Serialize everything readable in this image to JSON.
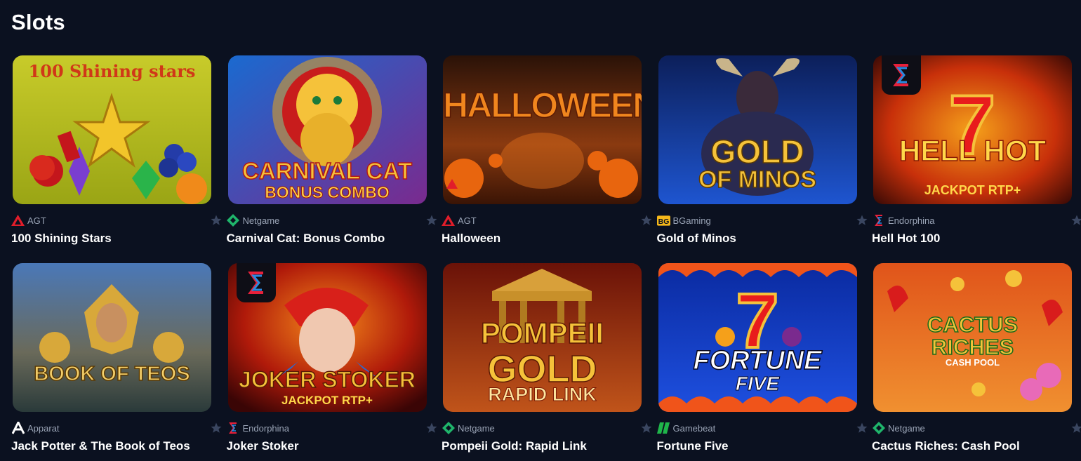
{
  "section": {
    "title": "Slots"
  },
  "games": [
    {
      "name": "100 Shining Stars",
      "provider": "AGT",
      "provider_icon": "agt-logo-icon",
      "art_text": "100 Shining stars",
      "colors": [
        "#c8cb2a",
        "#9aa515"
      ]
    },
    {
      "name": "Carnival Cat: Bonus Combo",
      "provider": "Netgame",
      "provider_icon": "netgame-logo-icon",
      "art_text": "CARNIVAL CAT",
      "art_sub": "BONUS COMBO",
      "colors": [
        "#1a6ad0",
        "#7a2a8e"
      ]
    },
    {
      "name": "Halloween",
      "provider": "AGT",
      "provider_icon": "agt-logo-icon",
      "art_text": "HALLOWEEN",
      "colors": [
        "#3a1a0c",
        "#c8521a"
      ]
    },
    {
      "name": "Gold of Minos",
      "provider": "BGaming",
      "provider_icon": "bgaming-logo-icon",
      "art_text": "GOLD",
      "art_sub": "OF MINOS",
      "colors": [
        "#102a7a",
        "#1e4fd0"
      ]
    },
    {
      "name": "Hell Hot 100",
      "provider": "Endorphina",
      "provider_icon": "endorphina-logo-icon",
      "art_text": "HELL HOT",
      "art_sub": "JACKPOT RTP+",
      "colors": [
        "#7a1a05",
        "#e04a10"
      ]
    },
    {
      "name": "Jack Potter & The Book of Teos",
      "provider": "Apparat",
      "provider_icon": "apparat-logo-icon",
      "art_text": "BOOK OF TEOS",
      "colors": [
        "#2b5fa5",
        "#8a6b3a"
      ]
    },
    {
      "name": "Joker Stoker",
      "provider": "Endorphina",
      "provider_icon": "endorphina-logo-icon",
      "art_text": "JOKER STOKER",
      "art_sub": "JACKPOT RTP+",
      "colors": [
        "#6a0a05",
        "#d8401a"
      ]
    },
    {
      "name": "Pompeii Gold: Rapid Link",
      "provider": "Netgame",
      "provider_icon": "netgame-logo-icon",
      "art_text": "POMPEII",
      "art_sub": "RAPID LINK",
      "colors": [
        "#5a0a05",
        "#c0541a"
      ]
    },
    {
      "name": "Fortune Five",
      "provider": "Gamebeat",
      "provider_icon": "gamebeat-logo-icon",
      "art_text": "FORTUNE",
      "art_sub": "FIVE",
      "colors": [
        "#0a2aa0",
        "#1e50e0"
      ]
    },
    {
      "name": "Cactus Riches: Cash Pool",
      "provider": "Netgame",
      "provider_icon": "netgame-logo-icon",
      "art_text": "CACTUS RICHES",
      "art_sub": "CASH POOL",
      "colors": [
        "#e0541a",
        "#f0a030"
      ]
    }
  ],
  "favorite_icon": "star-icon"
}
